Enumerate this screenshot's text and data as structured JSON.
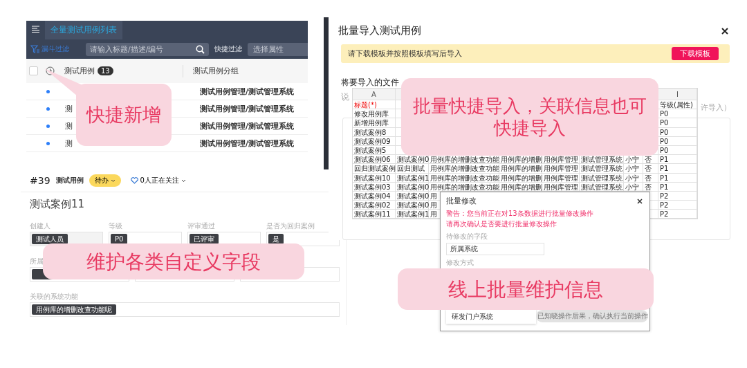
{
  "list_panel": {
    "tab": {
      "label": "全量测试用例列表",
      "selected": true
    },
    "filter_button": "漏斗过滤",
    "search": {
      "placeholder": "请输入标题/描述/编号"
    },
    "quick_filter_label": "快捷过滤",
    "attribute_select": {
      "placeholder": "选择属性"
    },
    "select_all": {
      "checked": false
    },
    "columns": [
      {
        "label": "测试用例",
        "count": "13"
      },
      {
        "label": "测试用例分组"
      }
    ],
    "rows": [
      {
        "group": "测试用例管理/测试管理系统"
      },
      {
        "title": "测",
        "group": "测试用例管理/测试管理系统"
      },
      {
        "title": "测",
        "group": "测试用例管理/测试管理系统"
      },
      {
        "title": "测",
        "group": "测试用例管理/测试管理系统"
      }
    ]
  },
  "detail_panel": {
    "id": "#39",
    "type": "测试用例",
    "status": "待办",
    "followers": "0人正在关注",
    "title": "测试案例11",
    "field_rows": [
      [
        {
          "label": "创建人",
          "value": "测试人员",
          "disabled": true
        },
        {
          "label": "等级",
          "value": "P0",
          "disabled": false
        },
        {
          "label": "评审通过",
          "value": "已评审",
          "disabled": false
        },
        {
          "label": "是否为回归案例",
          "value": "是",
          "disabled": false
        }
      ],
      [
        {
          "label": "所属"
        },
        {},
        {}
      ],
      [
        {
          "label": "关联的系统功能",
          "value": "用例库的增删改查功能呢",
          "disabled": false
        }
      ]
    ]
  },
  "import_dialog": {
    "title": "批量导入测试用例",
    "notice": "请下载模板并按照模板填写后导入",
    "download_button": "下载模板",
    "drop_heading": "将要导入的文件",
    "note": "说",
    "note_tail": "许导入）",
    "spreadsheet": {
      "rows": [
        {
          "kind": "letters",
          "a": "A",
          "i": "I"
        },
        {
          "kind": "title_row",
          "a": "标题(*)",
          "i": "等级(属性)"
        },
        {
          "kind": "data",
          "a": "修改用例库",
          "i": "P0"
        },
        {
          "kind": "data",
          "a": "新增用例库",
          "i": "P0"
        },
        {
          "kind": "data",
          "a": "测试案例8",
          "i": "P0"
        },
        {
          "kind": "data",
          "a": "测试案例09",
          "i": "P0"
        },
        {
          "kind": "data",
          "a": "测试案例5",
          "i": "P0"
        },
        {
          "kind": "data",
          "a": "测试案例06",
          "b": "测试案例0",
          "c": "用例库的增删改查功能",
          "d": "用例库的增删",
          "e": "用例库管理",
          "f": "测试管理系统",
          "g": "小宁",
          "h": "否",
          "i": "P1"
        },
        {
          "kind": "data",
          "a": "回归测试案例",
          "b": "回归测试",
          "c": "用例库的增删改查功能",
          "d": "用例库的增删",
          "e": "用例库管理",
          "f": "测试管理系统",
          "g": "小宁",
          "h": "否",
          "i": "P1"
        },
        {
          "kind": "data",
          "a": "测试案例10",
          "b": "测试案例1",
          "c": "用例库的增删改查功能",
          "d": "用例库的增删",
          "e": "用例库管理",
          "f": "测试管理系统",
          "g": "小宁",
          "h": "否",
          "i": "P1"
        },
        {
          "kind": "data",
          "a": "测试案例03",
          "b": "测试案例0",
          "c": "用例库的增删改查功能",
          "d": "用例库的增删",
          "e": "用例库管理",
          "f": "测试管理系统",
          "g": "小宁",
          "h": "否",
          "i": "P1"
        },
        {
          "kind": "data",
          "a": "测试案例04",
          "b": "测试案例0",
          "c": "用",
          "i": "P2"
        },
        {
          "kind": "data",
          "a": "测试案例02",
          "b": "测试案例0",
          "c": "用",
          "i": "P2"
        },
        {
          "kind": "data",
          "a": "测试案例11",
          "b": "测试案例1",
          "c": "用",
          "i": "P2"
        }
      ]
    }
  },
  "batch_edit_dialog": {
    "title": "批量修改",
    "warnings": [
      "警告：您当前正在对13条数据进行批量修改操作",
      "请再次确认是否要进行批量修改操作"
    ],
    "field_label": "待修改的字段",
    "field_value": "所属系统",
    "mode_label": "修改方式",
    "option": "研发门户系统",
    "confirm_button": {
      "label": "已知晓操作后果，确认执行当前操作",
      "disabled": true
    }
  },
  "callouts": [
    {
      "text": "快捷新增",
      "kind": "pointer"
    },
    {
      "text": "批量快捷导入，关联信息也可快捷导入",
      "kind": "plain"
    },
    {
      "text": "维护各类自定义字段",
      "kind": "plain"
    },
    {
      "text": "线上批量维护信息",
      "kind": "plain"
    }
  ]
}
